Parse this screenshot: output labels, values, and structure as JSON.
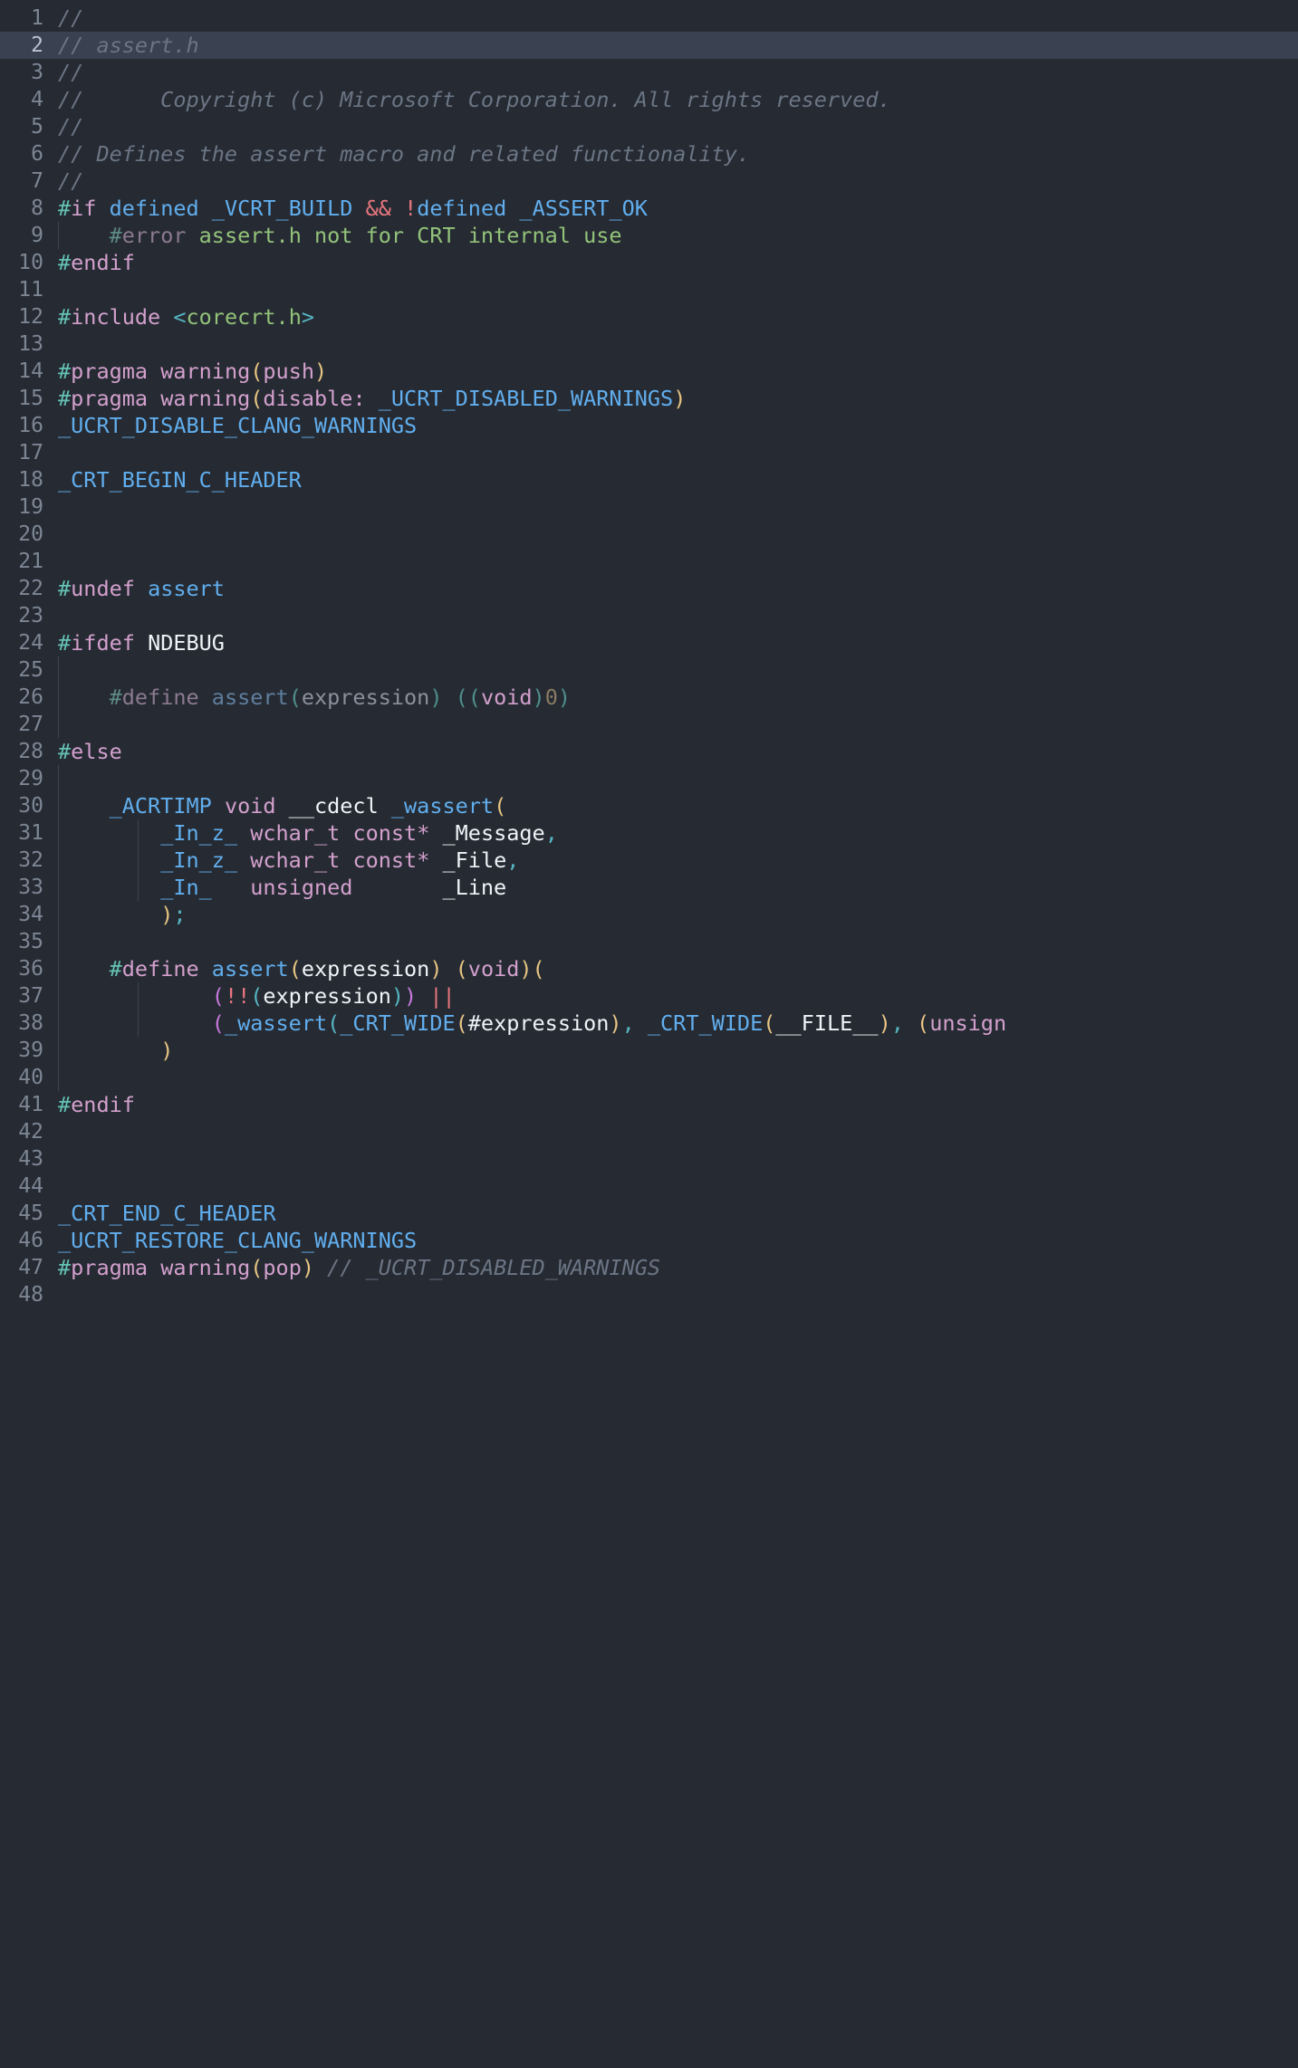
{
  "editor": {
    "file_name": "assert.h",
    "language": "C/C++ header",
    "theme_background": "#262b33",
    "active_line": 2,
    "total_lines": 48,
    "gutter_color": "#7d8694",
    "active_line_highlight": "#3a4150",
    "colors": {
      "comment": "#6b7584",
      "preprocessor_hash": "#64c2b5",
      "preprocessor_keyword": "#d3a0cd",
      "identifier": "#61aeee",
      "operator": "#e8767f",
      "string": "#93c37a",
      "variable": "#f0f3f7",
      "number": "#d19a66",
      "bracket_yellow": "#e8c583",
      "bracket_purple": "#c678dd",
      "bracket_teal": "#56b6c2",
      "inactive_region": "#636d7b"
    }
  },
  "lines": [
    {
      "n": 1,
      "text": "//"
    },
    {
      "n": 2,
      "text": "// assert.h"
    },
    {
      "n": 3,
      "text": "//"
    },
    {
      "n": 4,
      "text": "//      Copyright (c) Microsoft Corporation. All rights reserved."
    },
    {
      "n": 5,
      "text": "//"
    },
    {
      "n": 6,
      "text": "// Defines the assert macro and related functionality."
    },
    {
      "n": 7,
      "text": "//"
    },
    {
      "n": 8,
      "text": "#if defined _VCRT_BUILD && !defined _ASSERT_OK"
    },
    {
      "n": 9,
      "text": "    #error assert.h not for CRT internal use"
    },
    {
      "n": 10,
      "text": "#endif"
    },
    {
      "n": 11,
      "text": ""
    },
    {
      "n": 12,
      "text": "#include <corecrt.h>"
    },
    {
      "n": 13,
      "text": ""
    },
    {
      "n": 14,
      "text": "#pragma warning(push)"
    },
    {
      "n": 15,
      "text": "#pragma warning(disable: _UCRT_DISABLED_WARNINGS)"
    },
    {
      "n": 16,
      "text": "_UCRT_DISABLE_CLANG_WARNINGS"
    },
    {
      "n": 17,
      "text": ""
    },
    {
      "n": 18,
      "text": "_CRT_BEGIN_C_HEADER"
    },
    {
      "n": 19,
      "text": ""
    },
    {
      "n": 20,
      "text": ""
    },
    {
      "n": 21,
      "text": ""
    },
    {
      "n": 22,
      "text": "#undef assert"
    },
    {
      "n": 23,
      "text": ""
    },
    {
      "n": 24,
      "text": "#ifdef NDEBUG"
    },
    {
      "n": 25,
      "text": ""
    },
    {
      "n": 26,
      "text": "    #define assert(expression) ((void)0)"
    },
    {
      "n": 27,
      "text": ""
    },
    {
      "n": 28,
      "text": "#else"
    },
    {
      "n": 29,
      "text": ""
    },
    {
      "n": 30,
      "text": "    _ACRTIMP void __cdecl _wassert("
    },
    {
      "n": 31,
      "text": "        _In_z_ wchar_t const* _Message,"
    },
    {
      "n": 32,
      "text": "        _In_z_ wchar_t const* _File,"
    },
    {
      "n": 33,
      "text": "        _In_   unsigned       _Line"
    },
    {
      "n": 34,
      "text": "        );"
    },
    {
      "n": 35,
      "text": ""
    },
    {
      "n": 36,
      "text": "    #define assert(expression) (void)("
    },
    {
      "n": 37,
      "text": "            (!!(expression)) ||"
    },
    {
      "n": 38,
      "text": "            (_wassert(_CRT_WIDE(#expression), _CRT_WIDE(__FILE__), (unsign"
    },
    {
      "n": 39,
      "text": "        )"
    },
    {
      "n": 40,
      "text": ""
    },
    {
      "n": 41,
      "text": "#endif"
    },
    {
      "n": 42,
      "text": ""
    },
    {
      "n": 43,
      "text": ""
    },
    {
      "n": 44,
      "text": ""
    },
    {
      "n": 45,
      "text": "_CRT_END_C_HEADER"
    },
    {
      "n": 46,
      "text": "_UCRT_RESTORE_CLANG_WARNINGS"
    },
    {
      "n": 47,
      "text": "#pragma warning(pop) // _UCRT_DISABLED_WARNINGS"
    },
    {
      "n": 48,
      "text": ""
    }
  ]
}
